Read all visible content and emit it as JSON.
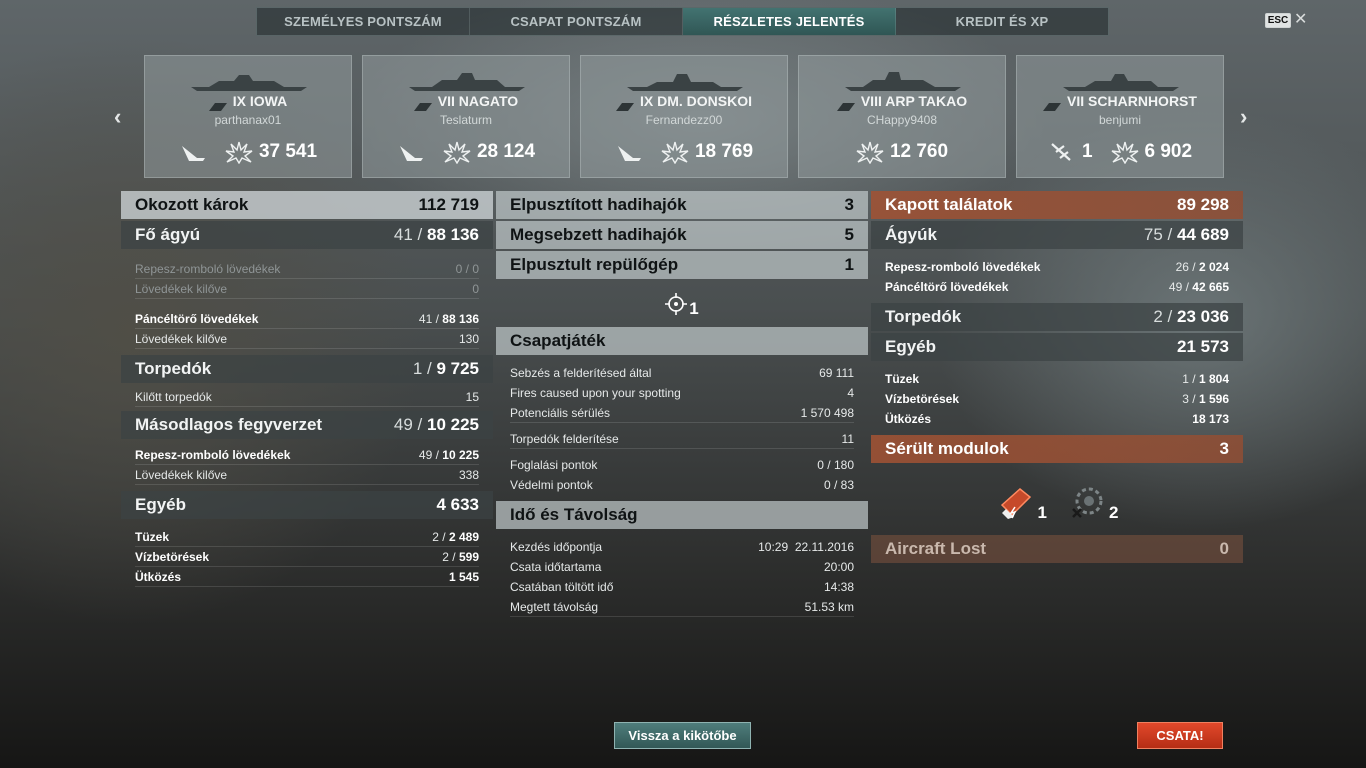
{
  "tabs": [
    {
      "label": "SZEMÉLYES PONTSZÁM"
    },
    {
      "label": "CSAPAT PONTSZÁM"
    },
    {
      "label": "RÉSZLETES JELENTÉS"
    },
    {
      "label": "KREDIT ÉS XP"
    }
  ],
  "esc_label": "ESC",
  "ships": [
    {
      "name": "IX IOWA",
      "player": "parthanax01",
      "damage": "37 541"
    },
    {
      "name": "VII NAGATO",
      "player": "Teslaturm",
      "damage": "28 124"
    },
    {
      "name": "IX DM. DONSKOI",
      "player": "Fernandezz00",
      "damage": "18 769"
    },
    {
      "name": "VIII ARP TAKAO",
      "player": "CHappy9408",
      "damage": "12 760"
    },
    {
      "name": "VII SCHARNHORST",
      "player": "benjumi",
      "extra": "1",
      "damage": "6 902"
    }
  ],
  "left": {
    "damage_caused": {
      "label": "Okozott károk",
      "value": "112 719"
    },
    "main_guns": {
      "label": "Fő ágyú",
      "hits": "41",
      "total": "88 136"
    },
    "he_label": "Repesz-romboló lövedékek",
    "he_value": "0 / 0",
    "he_fired_label": "Lövedékek kilőve",
    "he_fired_value": "0",
    "ap_label": "Páncéltörő lövedékek",
    "ap_hits": "41",
    "ap_total": "88 136",
    "ap_fired_label": "Lövedékek kilőve",
    "ap_fired_value": "130",
    "torpedoes": {
      "label": "Torpedók",
      "hits": "1",
      "total": "9 725"
    },
    "torp_fired_label": "Kilőtt torpedók",
    "torp_fired_value": "15",
    "secondary": {
      "label": "Másodlagos fegyverzet",
      "hits": "49",
      "total": "10 225"
    },
    "sec_he_label": "Repesz-romboló lövedékek",
    "sec_he_hits": "49",
    "sec_he_total": "10 225",
    "sec_fired_label": "Lövedékek kilőve",
    "sec_fired_value": "338",
    "other": {
      "label": "Egyéb",
      "value": "4 633"
    },
    "fires_label": "Tüzek",
    "fires_count": "2",
    "fires_total": "2 489",
    "flooding_label": "Vízbetörések",
    "flooding_count": "2",
    "flooding_total": "599",
    "ram_label": "Ütközés",
    "ram_total": "1 545"
  },
  "middle": {
    "destroyed": {
      "label": "Elpusztított hadihajók",
      "value": "3"
    },
    "damaged": {
      "label": "Megsebzett hadihajók",
      "value": "5"
    },
    "planes": {
      "label": "Elpusztult repülőgép",
      "value": "1"
    },
    "spotted_count": "1",
    "team": {
      "label": "Csapatjáték"
    },
    "spot_dmg_label": "Sebzés a felderítésed által",
    "spot_dmg_value": "69 111",
    "spot_fires_label": "Fires caused upon your spotting",
    "spot_fires_value": "4",
    "potential_label": "Potenciális sérülés",
    "potential_value": "1 570 498",
    "torp_spot_label": "Torpedók felderítése",
    "torp_spot_value": "11",
    "capture_label": "Foglalási pontok",
    "capture_value": "0 / 180",
    "defense_label": "Védelmi pontok",
    "defense_value": "0 / 83",
    "time": {
      "label": "Idő és Távolság"
    },
    "start_label": "Kezdés időpontja",
    "start_time": "10:29",
    "start_date": "22.11.2016",
    "duration_label": "Csata időtartama",
    "duration_value": "20:00",
    "time_in_battle_label": "Csatában töltött idő",
    "time_in_battle_value": "14:38",
    "distance_label": "Megtett távolság",
    "distance_value": "51.53 km"
  },
  "right": {
    "hits_received": {
      "label": "Kapott találatok",
      "value": "89 298"
    },
    "guns": {
      "label": "Ágyúk",
      "hits": "75",
      "total": "44 689"
    },
    "he_label": "Repesz-romboló lövedékek",
    "he_hits": "26",
    "he_total": "2 024",
    "ap_label": "Páncéltörő lövedékek",
    "ap_hits": "49",
    "ap_total": "42 665",
    "torpedoes": {
      "label": "Torpedók",
      "hits": "2",
      "total": "23 036"
    },
    "other": {
      "label": "Egyéb",
      "value": "21 573"
    },
    "fires_label": "Tüzek",
    "fires_count": "1",
    "fires_total": "1 804",
    "flooding_label": "Vízbetörések",
    "flooding_count": "3",
    "flooding_total": "1 596",
    "ram_label": "Ütközés",
    "ram_total": "18 173",
    "modules": {
      "label": "Sérült modulok",
      "value": "3"
    },
    "module_1_count": "1",
    "module_2_count": "2",
    "aircraft_lost": {
      "label": "Aircraft Lost",
      "value": "0"
    }
  },
  "buttons": {
    "port": "Vissza a kikötőbe",
    "battle": "CSATA!"
  }
}
